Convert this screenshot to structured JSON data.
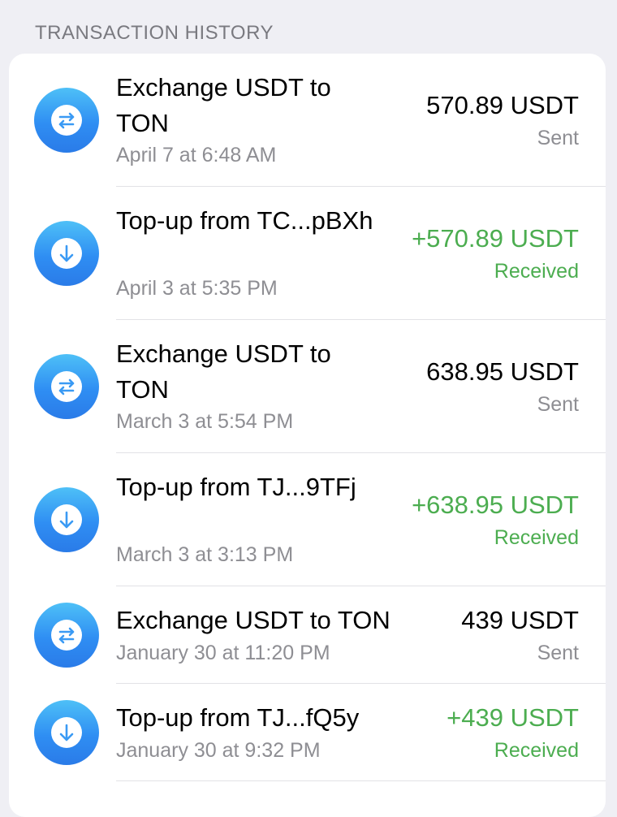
{
  "header": {
    "title": "TRANSACTION HISTORY"
  },
  "colors": {
    "accent_green": "#4cad50",
    "icon_blue": "#2f8ef3",
    "secondary_text": "#8e8e93"
  },
  "transactions": [
    {
      "icon": "exchange-arrows-icon",
      "title": "Exchange USDT to TON",
      "date": "April 7 at 6:48 AM",
      "amount": "570.89 USDT",
      "status": "Sent"
    },
    {
      "icon": "arrow-down-icon",
      "title": "Top-up from TC...pBXh",
      "date": "April 3 at 5:35 PM",
      "amount": "+570.89 USDT",
      "status": "Received"
    },
    {
      "icon": "exchange-arrows-icon",
      "title": "Exchange USDT to TON",
      "date": "March 3 at 5:54 PM",
      "amount": "638.95 USDT",
      "status": "Sent"
    },
    {
      "icon": "arrow-down-icon",
      "title": "Top-up from TJ...9TFj",
      "date": "March 3 at 3:13 PM",
      "amount": "+638.95 USDT",
      "status": "Received"
    },
    {
      "icon": "exchange-arrows-icon",
      "title": "Exchange USDT to TON",
      "date": "January 30 at 11:20 PM",
      "amount": "439 USDT",
      "status": "Sent"
    },
    {
      "icon": "arrow-down-icon",
      "title": "Top-up from TJ...fQ5y",
      "date": "January 30 at 9:32 PM",
      "amount": "+439 USDT",
      "status": "Received"
    }
  ]
}
